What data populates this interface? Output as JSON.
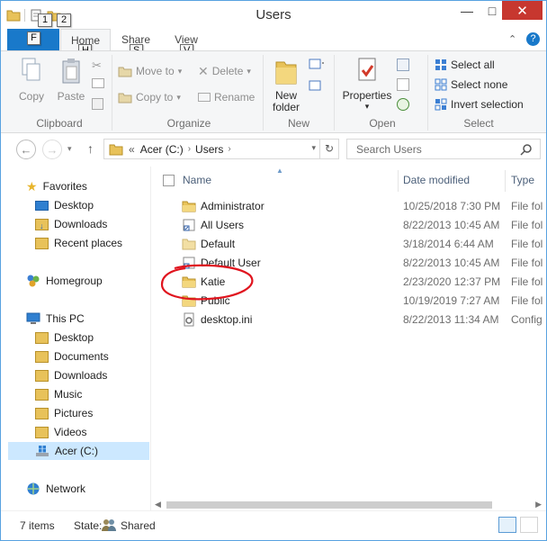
{
  "window": {
    "title": "Users"
  },
  "qat": {
    "keytip_1": "1",
    "keytip_2": "2"
  },
  "tabs": {
    "file": {
      "label": "F"
    },
    "home": {
      "label": "Home",
      "keytip": "H"
    },
    "share": {
      "label": "Share",
      "keytip": "S"
    },
    "view": {
      "label": "View",
      "keytip": "V"
    }
  },
  "ribbon": {
    "clipboard": {
      "group": "Clipboard",
      "copy": "Copy",
      "paste": "Paste"
    },
    "organize": {
      "group": "Organize",
      "move_to": "Move to",
      "copy_to": "Copy to",
      "delete": "Delete",
      "rename": "Rename"
    },
    "new": {
      "group": "New",
      "new_folder": "New folder"
    },
    "open": {
      "group": "Open",
      "properties": "Properties"
    },
    "select": {
      "group": "Select",
      "select_all": "Select all",
      "select_none": "Select none",
      "invert_selection": "Invert selection"
    }
  },
  "address": {
    "overflow": "«",
    "crumbs": [
      "Acer (C:)",
      "Users"
    ],
    "search_placeholder": "Search Users"
  },
  "nav": {
    "favorites": {
      "label": "Favorites",
      "items": [
        "Desktop",
        "Downloads",
        "Recent places"
      ]
    },
    "homegroup": "Homegroup",
    "this_pc": {
      "label": "This PC",
      "items": [
        "Desktop",
        "Documents",
        "Downloads",
        "Music",
        "Pictures",
        "Videos",
        "Acer (C:)"
      ]
    },
    "network": "Network"
  },
  "columns": {
    "name": "Name",
    "date_modified": "Date modified",
    "type": "Type"
  },
  "files": [
    {
      "name": "Administrator",
      "date": "10/25/2018 7:30 PM",
      "type": "File fol",
      "icon": "folder-icon"
    },
    {
      "name": "All Users",
      "date": "8/22/2013 10:45 AM",
      "type": "File fol",
      "icon": "shortcut-folder-icon"
    },
    {
      "name": "Default",
      "date": "3/18/2014 6:44 AM",
      "type": "File fol",
      "icon": "folder-light-icon"
    },
    {
      "name": "Default User",
      "date": "8/22/2013 10:45 AM",
      "type": "File fol",
      "icon": "shortcut-folder-icon"
    },
    {
      "name": "Katie",
      "date": "2/23/2020 12:37 PM",
      "type": "File fol",
      "icon": "folder-icon"
    },
    {
      "name": "Public",
      "date": "10/19/2019 7:27 AM",
      "type": "File fol",
      "icon": "folder-icon"
    },
    {
      "name": "desktop.ini",
      "date": "8/22/2013 11:34 AM",
      "type": "Config",
      "icon": "settings-file-icon"
    }
  ],
  "status": {
    "items": "7 items",
    "state_label": "State:",
    "state_value": "Shared"
  },
  "colors": {
    "accent": "#1979ca",
    "folder": "#e8c25a",
    "highlight_circle": "#e0141e",
    "selected": "#cce8ff"
  }
}
